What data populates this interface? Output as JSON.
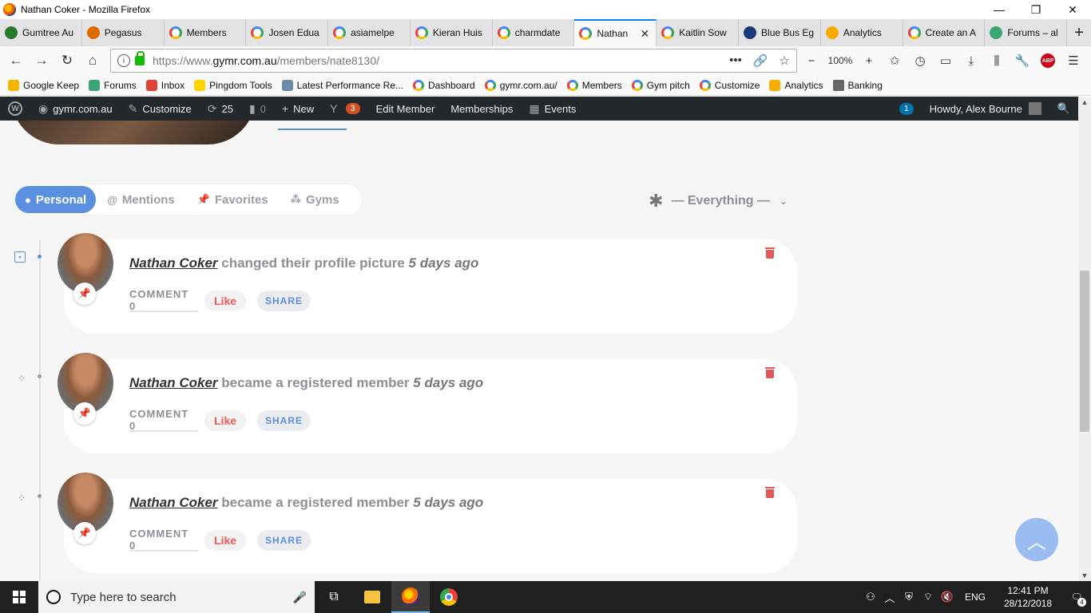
{
  "window": {
    "title": "Nathan Coker - Mozilla Firefox",
    "controls": {
      "minimize": "—",
      "restore": "❐",
      "close": "✕"
    }
  },
  "tabs": [
    {
      "label": "Gumtree Au",
      "icon": "gumtree-icon",
      "color": "#2a7a2a"
    },
    {
      "label": "Pegasus",
      "icon": "pegasus-icon",
      "color": "#e06a00"
    },
    {
      "label": "Members",
      "icon": "google-icon",
      "color": "#4285f4"
    },
    {
      "label": "Josen Edua",
      "icon": "google-icon",
      "color": "#4285f4"
    },
    {
      "label": "asiamelpe",
      "icon": "google-icon",
      "color": "#4285f4"
    },
    {
      "label": "Kieran Huis",
      "icon": "google-icon",
      "color": "#4285f4"
    },
    {
      "label": "charmdate",
      "icon": "google-icon",
      "color": "#4285f4"
    },
    {
      "label": "Nathan",
      "icon": "google-icon",
      "color": "#4285f4",
      "active": true,
      "close": "✕"
    },
    {
      "label": "Kaitlin Sow",
      "icon": "google-icon",
      "color": "#4285f4"
    },
    {
      "label": "Blue Bus Eg",
      "icon": "bluebus-icon",
      "color": "#1a3a7a"
    },
    {
      "label": "Analytics",
      "icon": "analytics-icon",
      "color": "#f9ab00"
    },
    {
      "label": "Create an A",
      "icon": "google-icon",
      "color": "#4285f4"
    },
    {
      "label": "Forums – al",
      "icon": "forums-icon",
      "color": "#3aa676"
    }
  ],
  "new_tab": "+",
  "navbar": {
    "back": "←",
    "forward": "→",
    "reload": "↻",
    "home": "⌂",
    "url_prefix": "https://www.",
    "url_domain": "gymr.com.au",
    "url_path": "/members/nate8130/",
    "page_actions": "•••",
    "zoom": "100%",
    "zoom_out": "−",
    "zoom_in": "+",
    "abp": "ABP",
    "menu": "☰"
  },
  "bookmarks": [
    {
      "label": "Google Keep",
      "icon": "keep-icon",
      "color": "#f4b400"
    },
    {
      "label": "Forums",
      "icon": "forums-icon",
      "color": "#3aa676"
    },
    {
      "label": "Inbox",
      "icon": "gmail-icon",
      "color": "#db4437"
    },
    {
      "label": "Pingdom Tools",
      "icon": "pingdom-icon",
      "color": "#ffd200"
    },
    {
      "label": "Latest Performance Re...",
      "icon": "gtmetrix-icon",
      "color": "#6a8aaa"
    },
    {
      "label": "Dashboard",
      "icon": "google-icon",
      "color": "#4285f4"
    },
    {
      "label": "gymr.com.au/",
      "icon": "google-icon",
      "color": "#4285f4"
    },
    {
      "label": "Members",
      "icon": "google-icon",
      "color": "#4285f4"
    },
    {
      "label": "Gym pitch",
      "icon": "google-icon",
      "color": "#4285f4"
    },
    {
      "label": "Customize",
      "icon": "google-icon",
      "color": "#4285f4"
    },
    {
      "label": "Analytics",
      "icon": "analytics-icon",
      "color": "#f9ab00"
    },
    {
      "label": "Banking",
      "icon": "folder-icon",
      "color": "#666666"
    }
  ],
  "wpbar": {
    "site": "gymr.com.au",
    "customize": "Customize",
    "updates": "25",
    "comments": "0",
    "new": "New",
    "yoast_count": "3",
    "edit_member": "Edit Member",
    "memberships": "Memberships",
    "events": "Events",
    "notif_count": "1",
    "howdy": "Howdy, Alex Bourne"
  },
  "filters": {
    "tabs": [
      {
        "label": "Personal",
        "active": true,
        "icon": "person-icon"
      },
      {
        "label": "Mentions",
        "icon": "at-icon"
      },
      {
        "label": "Favorites",
        "icon": "pin-icon"
      },
      {
        "label": "Gyms",
        "icon": "group-icon"
      }
    ],
    "dropdown": "— Everything —"
  },
  "activities": [
    {
      "name": "Nathan Coker",
      "action": "changed their profile picture",
      "time": "5 days ago",
      "comment": "COMMENT 0",
      "like": "Like",
      "share": "SHARE"
    },
    {
      "name": "Nathan Coker",
      "action": "became a registered member",
      "time": "5 days ago",
      "comment": "COMMENT 0",
      "like": "Like",
      "share": "SHARE"
    },
    {
      "name": "Nathan Coker",
      "action": "became a registered member",
      "time": "5 days ago",
      "comment": "COMMENT 0",
      "like": "Like",
      "share": "SHARE"
    }
  ],
  "taskbar": {
    "search_placeholder": "Type here to search",
    "lang": "ENG",
    "time": "12:41 PM",
    "date": "28/12/2018",
    "notif_count": "4"
  }
}
